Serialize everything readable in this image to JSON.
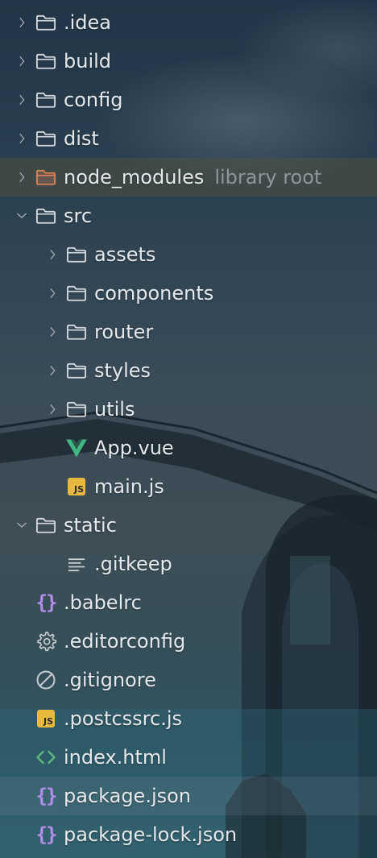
{
  "project_tree": {
    "items": [
      {
        "name": ".idea",
        "kind": "folder",
        "depth": 0,
        "expanded": false
      },
      {
        "name": "build",
        "kind": "folder",
        "depth": 0,
        "expanded": false
      },
      {
        "name": "config",
        "kind": "folder",
        "depth": 0,
        "expanded": false
      },
      {
        "name": "dist",
        "kind": "folder",
        "depth": 0,
        "expanded": false
      },
      {
        "name": "node_modules",
        "kind": "folder-library",
        "depth": 0,
        "expanded": false,
        "hint": "library root"
      },
      {
        "name": "src",
        "kind": "folder",
        "depth": 0,
        "expanded": true
      },
      {
        "name": "assets",
        "kind": "folder",
        "depth": 1,
        "expanded": false
      },
      {
        "name": "components",
        "kind": "folder",
        "depth": 1,
        "expanded": false
      },
      {
        "name": "router",
        "kind": "folder",
        "depth": 1,
        "expanded": false
      },
      {
        "name": "styles",
        "kind": "folder",
        "depth": 1,
        "expanded": false
      },
      {
        "name": "utils",
        "kind": "folder",
        "depth": 1,
        "expanded": false
      },
      {
        "name": "App.vue",
        "kind": "vue",
        "depth": 1
      },
      {
        "name": "main.js",
        "kind": "js",
        "depth": 1
      },
      {
        "name": "static",
        "kind": "folder",
        "depth": 0,
        "expanded": true
      },
      {
        "name": ".gitkeep",
        "kind": "text",
        "depth": 1
      },
      {
        "name": ".babelrc",
        "kind": "json",
        "depth": 0
      },
      {
        "name": ".editorconfig",
        "kind": "config",
        "depth": 0
      },
      {
        "name": ".gitignore",
        "kind": "ignore",
        "depth": 0
      },
      {
        "name": ".postcssrc.js",
        "kind": "js",
        "depth": 0
      },
      {
        "name": "index.html",
        "kind": "html",
        "depth": 0
      },
      {
        "name": "package.json",
        "kind": "json",
        "depth": 0,
        "selected": true
      },
      {
        "name": "package-lock.json",
        "kind": "json",
        "depth": 0
      }
    ]
  },
  "icons": {
    "folder": "folder-icon",
    "folder-library": "library-folder-icon",
    "vue": "vue-icon",
    "js": "javascript-file-icon",
    "text": "text-file-icon",
    "json": "json-file-icon",
    "config": "gear-icon",
    "ignore": "ignore-file-icon",
    "html": "html-file-icon"
  },
  "badges": {
    "js": "JS",
    "json": "{}"
  },
  "colors": {
    "label": "#e6e9ec",
    "hint": "#8e969c",
    "folder_outline": "#d4d8dc",
    "library_folder": "#d9825a",
    "vue_green": "#41b883",
    "js_yellow": "#e8b93e",
    "json_purple": "#b18fe8",
    "html_green": "#5fb87a"
  }
}
